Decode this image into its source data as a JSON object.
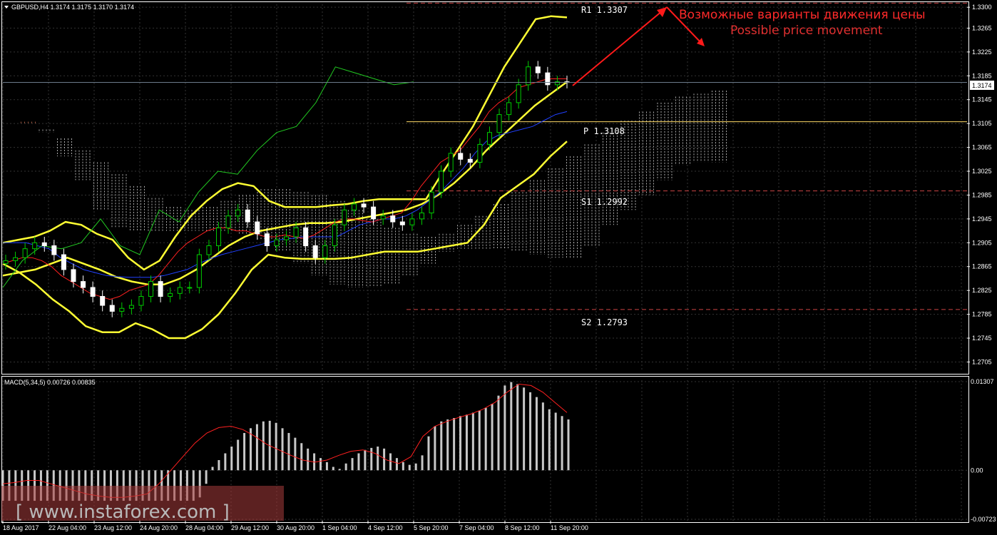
{
  "header": {
    "symbol_line": "GBPUSD,H4  1.3174 1.3175 1.3170 1.3174",
    "macd_line": "MACD(5,34,5) 0.00726 0.00835"
  },
  "price_axis": {
    "ticks": [
      "1.3300",
      "1.3265",
      "1.3225",
      "1.3185",
      "1.3145",
      "1.3105",
      "1.3065",
      "1.3025",
      "1.2985",
      "1.2945",
      "1.2905",
      "1.2865",
      "1.2825",
      "1.2785",
      "1.2745",
      "1.2705"
    ],
    "current_price": "1.3174"
  },
  "macd_axis": {
    "ticks": [
      "0.01307",
      "0.00",
      "-0.00723"
    ]
  },
  "time_axis": {
    "labels": [
      "18 Aug 2017",
      "22 Aug 04:00",
      "23 Aug 12:00",
      "24 Aug 20:00",
      "28 Aug 04:00",
      "29 Aug 12:00",
      "30 Aug 20:00",
      "1 Sep 04:00",
      "4 Sep 12:00",
      "5 Sep 20:00",
      "7 Sep 04:00",
      "8 Sep 12:00",
      "11 Sep 20:00"
    ]
  },
  "levels": {
    "r1": "R1  1.3307",
    "p": "P  1.3108",
    "s1": "S1  1.2992",
    "s2": "S2  1.2793"
  },
  "annotation": {
    "line_ru": "Возможные варианты движения цены",
    "line_en": "Possible price movement"
  },
  "watermark": "[ www.instaforex.com ]",
  "colors": {
    "bull": "#00cc00",
    "bear": "#ffffff",
    "bands": "#ffff33",
    "tenkan": "#ff2020",
    "kijun": "#2040ff",
    "chikou": "#22cc22",
    "pivot": "#ffd966",
    "levels": "#cc4444",
    "macd_hist": "#c8c8c8",
    "macd_signal": "#ff2020",
    "arrow": "#ff1a1a"
  },
  "chart_data": {
    "type": "candlestick",
    "symbol": "GBPUSD",
    "timeframe": "H4",
    "ylim": [
      1.269,
      1.3305
    ],
    "current_price": 1.3174,
    "levels": {
      "R1": 1.3307,
      "P": 1.3108,
      "S1": 1.2992,
      "S2": 1.2793
    },
    "close": [
      1.2875,
      1.288,
      1.2895,
      1.2905,
      1.29,
      1.2885,
      1.286,
      1.284,
      1.283,
      1.2815,
      1.28,
      1.279,
      1.2795,
      1.28,
      1.2815,
      1.284,
      1.2815,
      1.282,
      1.283,
      1.283,
      1.2885,
      1.29,
      1.293,
      1.295,
      1.296,
      1.294,
      1.292,
      1.29,
      1.291,
      1.2915,
      1.293,
      1.29,
      1.288,
      1.29,
      1.2935,
      1.296,
      1.297,
      1.2965,
      1.2945,
      1.295,
      1.294,
      1.2935,
      1.2945,
      1.2955,
      1.299,
      1.3025,
      1.3055,
      1.3045,
      1.304,
      1.307,
      1.309,
      1.312,
      1.314,
      1.317,
      1.32,
      1.319,
      1.317,
      1.3175,
      1.3174
    ],
    "tenkan": [
      1.287,
      1.2875,
      1.288,
      1.288,
      1.2875,
      1.2865,
      1.285,
      1.284,
      1.283,
      1.282,
      1.2815,
      1.281,
      1.2815,
      1.2825,
      1.283,
      1.2835,
      1.285,
      1.287,
      1.289,
      1.2905,
      1.2915,
      1.2925,
      1.293,
      1.293,
      1.2925,
      1.2925,
      1.292,
      1.2915,
      1.2915,
      1.2918,
      1.2915,
      1.2912,
      1.2918,
      1.2928,
      1.2938,
      1.2945,
      1.2945,
      1.2942,
      1.294,
      1.2945,
      1.295,
      1.2955,
      1.2975,
      1.3,
      1.302,
      1.304,
      1.305,
      1.306,
      1.308,
      1.31,
      1.3125,
      1.314,
      1.315,
      1.3165,
      1.317,
      1.3175,
      1.318,
      1.318,
      1.318
    ],
    "kijun": [
      1.2905,
      1.2905,
      1.2905,
      1.29,
      1.2895,
      1.288,
      1.287,
      1.286,
      1.2855,
      1.285,
      1.2848,
      1.2847,
      1.2847,
      1.2847,
      1.285,
      1.2855,
      1.286,
      1.287,
      1.2878,
      1.2885,
      1.289,
      1.2895,
      1.29,
      1.2905,
      1.291,
      1.2912,
      1.2915,
      1.2915,
      1.2915,
      1.2915,
      1.2925,
      1.2935,
      1.294,
      1.2945,
      1.2945,
      1.295,
      1.296,
      1.2975,
      1.299,
      1.301,
      1.303,
      1.3055,
      1.3075,
      1.3085,
      1.309,
      1.3095,
      1.31,
      1.311,
      1.312,
      1.3125
    ],
    "bb_upper": [
      1.2905,
      1.291,
      1.2915,
      1.2925,
      1.294,
      1.2935,
      1.292,
      1.291,
      1.288,
      1.286,
      1.2875,
      1.2915,
      1.295,
      1.2975,
      1.2995,
      1.3005,
      1.3,
      1.2975,
      1.2965,
      1.2965,
      1.2965,
      1.2968,
      1.297,
      1.2975,
      1.2978,
      1.2978,
      1.2978,
      1.2978,
      1.302,
      1.306,
      1.31,
      1.315,
      1.32,
      1.324,
      1.328,
      1.3285,
      1.3283
    ],
    "bb_middle": [
      1.285,
      1.2855,
      1.286,
      1.287,
      1.288,
      1.287,
      1.286,
      1.2848,
      1.284,
      1.2835,
      1.2835,
      1.2845,
      1.286,
      1.288,
      1.29,
      1.2915,
      1.2925,
      1.293,
      1.2935,
      1.2938,
      1.2938,
      1.294,
      1.2945,
      1.295,
      1.2955,
      1.296,
      1.297,
      1.2985,
      1.3005,
      1.303,
      1.306,
      1.3085,
      1.311,
      1.3135,
      1.3155,
      1.3175
    ],
    "bb_lower": [
      1.287,
      1.2855,
      1.2835,
      1.281,
      1.279,
      1.2765,
      1.2755,
      1.2755,
      1.277,
      1.276,
      1.2745,
      1.2745,
      1.276,
      1.2785,
      1.282,
      1.286,
      1.2885,
      1.288,
      1.2878,
      1.2878,
      1.2878,
      1.288,
      1.2885,
      1.289,
      1.289,
      1.289,
      1.2895,
      1.29,
      1.2905,
      1.2935,
      1.298,
      1.3,
      1.302,
      1.305,
      1.3075
    ],
    "chikou": [
      1.283,
      1.2875,
      1.29,
      1.2895,
      1.2905,
      1.2945,
      1.29,
      1.2885,
      1.296,
      1.294,
      1.299,
      1.3025,
      1.302,
      1.306,
      1.309,
      1.31,
      1.314,
      1.32,
      1.319,
      1.318,
      1.317,
      1.3175
    ],
    "macd_hist": [
      -0.0045,
      -0.0045,
      -0.0045,
      -0.0045,
      -0.0045,
      -0.0045,
      -0.0045,
      -0.0045,
      -0.0045,
      -0.0045,
      -0.0045,
      -0.0045,
      -0.0045,
      -0.0045,
      -0.0045,
      -0.0045,
      -0.0045,
      -0.0045,
      -0.0045,
      -0.0045,
      -0.0045,
      -0.0045,
      -0.0045,
      -0.0045,
      -0.0045,
      -0.0045,
      -0.0045,
      -0.0045,
      -0.0045,
      -0.0045,
      -0.0045,
      -0.004,
      -0.002,
      0.0005,
      0.0015,
      0.0025,
      0.0035,
      0.0045,
      0.0055,
      0.0062,
      0.0068,
      0.0072,
      0.0073,
      0.007,
      0.0062,
      0.0055,
      0.0048,
      0.004,
      0.0032,
      0.0025,
      0.0018,
      0.0012,
      0.0005,
      0.0002,
      0.001,
      0.0018,
      0.0025,
      0.003,
      0.0033,
      0.0035,
      0.0032,
      0.0025,
      0.0018,
      0.0012,
      0.0008,
      0.001,
      0.0022,
      0.005,
      0.0065,
      0.0072,
      0.0075,
      0.0077,
      0.008,
      0.0082,
      0.0085,
      0.0088,
      0.0092,
      0.0098,
      0.011,
      0.0125,
      0.013,
      0.0127,
      0.0122,
      0.0115,
      0.0108,
      0.01,
      0.009,
      0.0085,
      0.008,
      0.0075
    ],
    "macd_signal": [
      -0.002,
      -0.0018,
      -0.0015,
      -0.0015,
      -0.002,
      -0.0025,
      -0.003,
      -0.0035,
      -0.0038,
      -0.004,
      -0.004,
      -0.0038,
      -0.0035,
      -0.002,
      0.0,
      0.002,
      0.004,
      0.0055,
      0.0063,
      0.0065,
      0.006,
      0.005,
      0.0038,
      0.003,
      0.0022,
      0.0015,
      0.0012,
      0.0015,
      0.0022,
      0.0028,
      0.003,
      0.0025,
      0.0015,
      0.001,
      0.002,
      0.005,
      0.0065,
      0.0072,
      0.0078,
      0.0083,
      0.009,
      0.01,
      0.0115,
      0.0127,
      0.0125,
      0.0115,
      0.01,
      0.0085
    ]
  }
}
